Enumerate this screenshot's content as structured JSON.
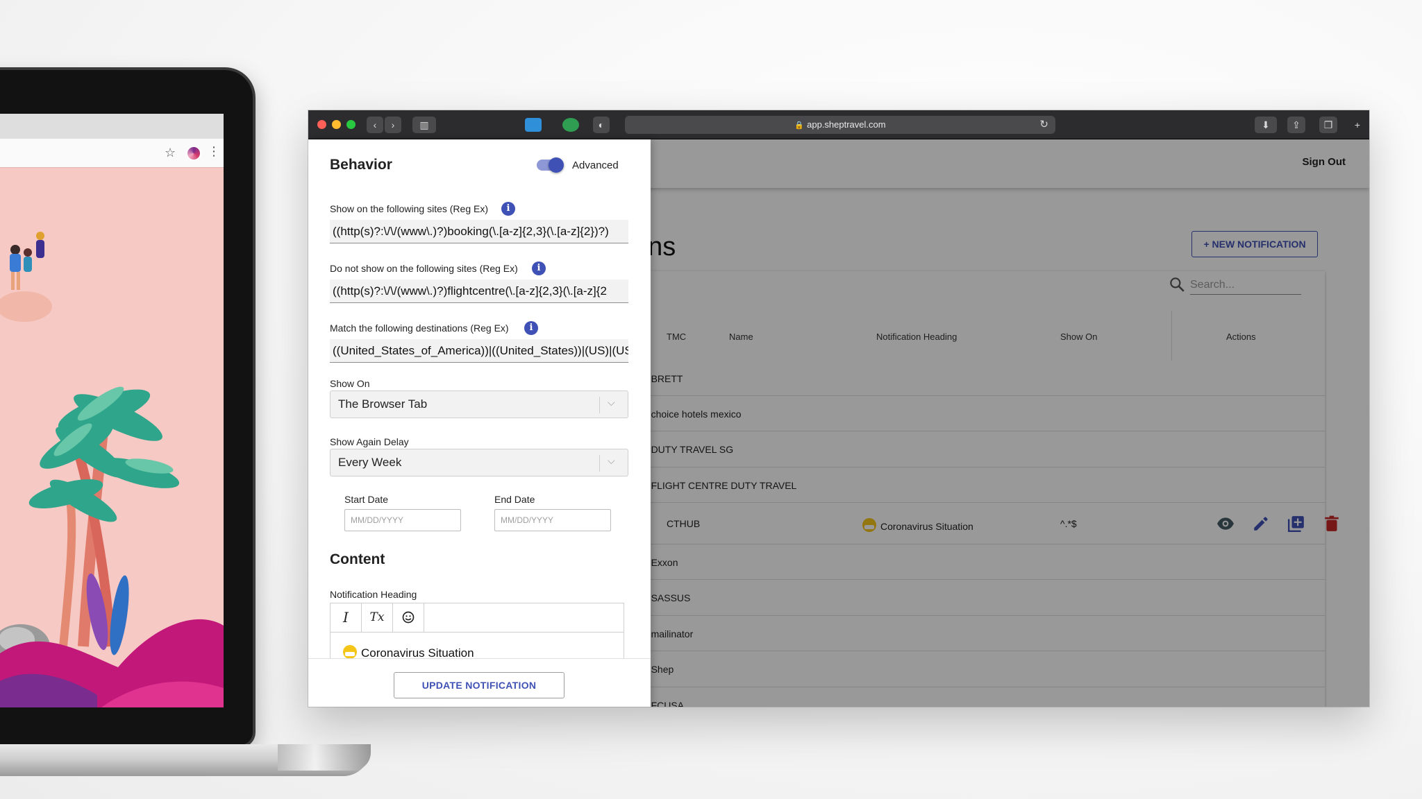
{
  "browser": {
    "url": "app.sheptravel.com"
  },
  "header": {
    "sign_out": "Sign Out"
  },
  "page": {
    "title_fragment": "ons",
    "new_notification": "+ NEW NOTIFICATION",
    "search_placeholder": "Search..."
  },
  "table": {
    "columns": [
      "TMC",
      "Name",
      "Notification Heading",
      "Show On",
      "Actions"
    ],
    "rows": [
      {
        "tmc_fragment": "e: BRETT"
      },
      {
        "tmc_fragment": "e: choice hotels mexico"
      },
      {
        "tmc_fragment": "e: DUTY TRAVEL SG"
      },
      {
        "tmc_fragment": "e: FLIGHT CENTRE DUTY TRAVEL"
      },
      {
        "tmc": "CTHUB",
        "heading": "Coronavirus Situation",
        "show_on": "^.*$"
      },
      {
        "tmc_fragment": "e: Exxon"
      },
      {
        "tmc_fragment": "e: SASSUS"
      },
      {
        "tmc_fragment": "e: mailinator"
      },
      {
        "tmc_fragment": "e: Shep"
      },
      {
        "tmc_fragment": "e: FCUSA"
      }
    ]
  },
  "drawer": {
    "behavior_title": "Behavior",
    "advanced_label": "Advanced",
    "advanced_on": true,
    "show_sites_label": "Show on the following sites (Reg Ex)",
    "show_sites_value": "((http(s)?:\\/\\/(www\\.)?)booking(\\.[a-z]{2,3}(\\.[a-z]{2})?)",
    "hide_sites_label": "Do not show on the following sites (Reg Ex)",
    "hide_sites_value": "((http(s)?:\\/\\/(www\\.)?)flightcentre(\\.[a-z]{2,3}(\\.[a-z]{2",
    "destinations_label": "Match the following destinations (Reg Ex)",
    "destinations_value": "((United_States_of_America))|((United_States))|(US)|(US",
    "show_on_label": "Show On",
    "show_on_value": "The Browser Tab",
    "delay_label": "Show Again Delay",
    "delay_value": "Every Week",
    "start_date_label": "Start Date",
    "end_date_label": "End Date",
    "date_placeholder": "MM/DD/YYYY",
    "content_title": "Content",
    "heading_label": "Notification Heading",
    "heading_value": "Coronavirus Situation",
    "update_button": "UPDATE NOTIFICATION"
  },
  "icons": {
    "italic": "I",
    "clear_format": "Tx",
    "emoji": "smile-icon"
  },
  "colors": {
    "accent": "#3f51b5",
    "delete": "#c62828",
    "titlebar": "#2c2c2e"
  }
}
